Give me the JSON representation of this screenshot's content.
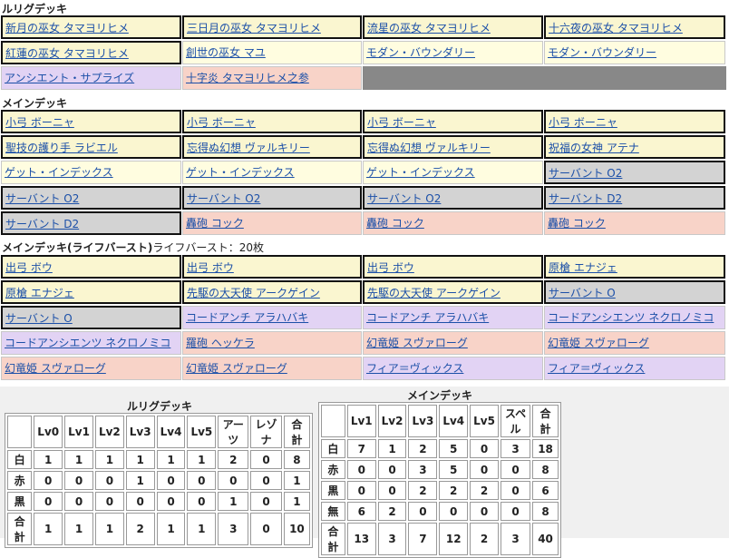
{
  "lrig_deck": {
    "title": "ルリグデッキ",
    "cards": [
      {
        "name": "新月の巫女 タマヨリヒメ",
        "style": "w"
      },
      {
        "name": "三日月の巫女 タマヨリヒメ",
        "style": "w"
      },
      {
        "name": "流星の巫女 タマヨリヒメ",
        "style": "w"
      },
      {
        "name": "十六夜の巫女 タマヨリヒメ",
        "style": "w"
      },
      {
        "name": "紅蓮の巫女 タマヨリヒメ",
        "style": "w"
      },
      {
        "name": "創世の巫女 マユ",
        "style": "p"
      },
      {
        "name": "モダン・バウンダリー",
        "style": "p"
      },
      {
        "name": "モダン・バウンダリー",
        "style": "p"
      },
      {
        "name": "アンシエント・サプライズ",
        "style": "u"
      },
      {
        "name": "十字炎 タマヨリヒメ之参",
        "style": "r"
      }
    ]
  },
  "main_deck": {
    "title": "メインデッキ",
    "cards": [
      {
        "name": "小弓 ボーニャ",
        "style": "w"
      },
      {
        "name": "小弓 ボーニャ",
        "style": "w"
      },
      {
        "name": "小弓 ボーニャ",
        "style": "w"
      },
      {
        "name": "小弓 ボーニャ",
        "style": "w"
      },
      {
        "name": "聖技の護り手 ラビエル",
        "style": "w"
      },
      {
        "name": "忘得ぬ幻想 ヴァルキリー",
        "style": "w"
      },
      {
        "name": "忘得ぬ幻想 ヴァルキリー",
        "style": "w"
      },
      {
        "name": "祝福の女神 アテナ",
        "style": "w"
      },
      {
        "name": "ゲット・インデックス",
        "style": "p"
      },
      {
        "name": "ゲット・インデックス",
        "style": "p"
      },
      {
        "name": "ゲット・インデックス",
        "style": "p"
      },
      {
        "name": "サーバント O2",
        "style": "g"
      },
      {
        "name": "サーバント O2",
        "style": "g"
      },
      {
        "name": "サーバント O2",
        "style": "g"
      },
      {
        "name": "サーバント O2",
        "style": "g"
      },
      {
        "name": "サーバント D2",
        "style": "g"
      },
      {
        "name": "サーバント D2",
        "style": "g"
      },
      {
        "name": "轟砲 コック",
        "style": "r"
      },
      {
        "name": "轟砲 コック",
        "style": "r"
      },
      {
        "name": "轟砲 コック",
        "style": "r"
      }
    ]
  },
  "lifeburst_deck": {
    "title": "メインデッキ(ライフバースト)",
    "count_label": "ライフバースト：20枚",
    "cards": [
      {
        "name": "出弓 ボウ",
        "style": "w"
      },
      {
        "name": "出弓 ボウ",
        "style": "w"
      },
      {
        "name": "出弓 ボウ",
        "style": "w"
      },
      {
        "name": "原槍 エナジェ",
        "style": "w"
      },
      {
        "name": "原槍 エナジェ",
        "style": "w"
      },
      {
        "name": "先駆の大天使 アークゲイン",
        "style": "w"
      },
      {
        "name": "先駆の大天使 アークゲイン",
        "style": "w"
      },
      {
        "name": "サーバント O",
        "style": "g"
      },
      {
        "name": "サーバント O",
        "style": "g"
      },
      {
        "name": "コードアンチ アラハバキ",
        "style": "u"
      },
      {
        "name": "コードアンチ アラハバキ",
        "style": "u"
      },
      {
        "name": "コードアンシエンツ ネクロノミコ",
        "style": "u"
      },
      {
        "name": "コードアンシエンツ ネクロノミコ",
        "style": "u"
      },
      {
        "name": "羅砲 ヘッケラ",
        "style": "r"
      },
      {
        "name": "幻竜姫 スヴァローグ",
        "style": "r"
      },
      {
        "name": "幻竜姫 スヴァローグ",
        "style": "r"
      },
      {
        "name": "幻竜姫 スヴァローグ",
        "style": "r"
      },
      {
        "name": "幻竜姫 スヴァローグ",
        "style": "r"
      },
      {
        "name": "フィア＝ヴィックス",
        "style": "u"
      },
      {
        "name": "フィア＝ヴィックス",
        "style": "u"
      }
    ]
  },
  "lrig_table": {
    "title": "ルリグデッキ",
    "headers": [
      "Lv0",
      "Lv1",
      "Lv2",
      "Lv3",
      "Lv4",
      "Lv5",
      "アーツ",
      "レゾナ",
      "合計"
    ],
    "rows": [
      {
        "label": "白",
        "values": [
          "1",
          "1",
          "1",
          "1",
          "1",
          "1",
          "2",
          "0",
          "8"
        ]
      },
      {
        "label": "赤",
        "values": [
          "0",
          "0",
          "0",
          "1",
          "0",
          "0",
          "0",
          "0",
          "1"
        ]
      },
      {
        "label": "黒",
        "values": [
          "0",
          "0",
          "0",
          "0",
          "0",
          "0",
          "1",
          "0",
          "1"
        ]
      },
      {
        "label": "合計",
        "values": [
          "1",
          "1",
          "1",
          "2",
          "1",
          "1",
          "3",
          "0",
          "10"
        ]
      }
    ]
  },
  "main_table": {
    "title": "メインデッキ",
    "headers": [
      "Lv1",
      "Lv2",
      "Lv3",
      "Lv4",
      "Lv5",
      "スペル",
      "合計"
    ],
    "rows": [
      {
        "label": "白",
        "values": [
          "7",
          "1",
          "2",
          "5",
          "0",
          "3",
          "18"
        ]
      },
      {
        "label": "赤",
        "values": [
          "0",
          "0",
          "3",
          "5",
          "0",
          "0",
          "8"
        ]
      },
      {
        "label": "黒",
        "values": [
          "0",
          "0",
          "2",
          "2",
          "2",
          "0",
          "6"
        ]
      },
      {
        "label": "無",
        "values": [
          "6",
          "2",
          "0",
          "0",
          "0",
          "0",
          "8"
        ]
      },
      {
        "label": "合計",
        "values": [
          "13",
          "3",
          "7",
          "12",
          "2",
          "3",
          "40"
        ]
      }
    ]
  }
}
